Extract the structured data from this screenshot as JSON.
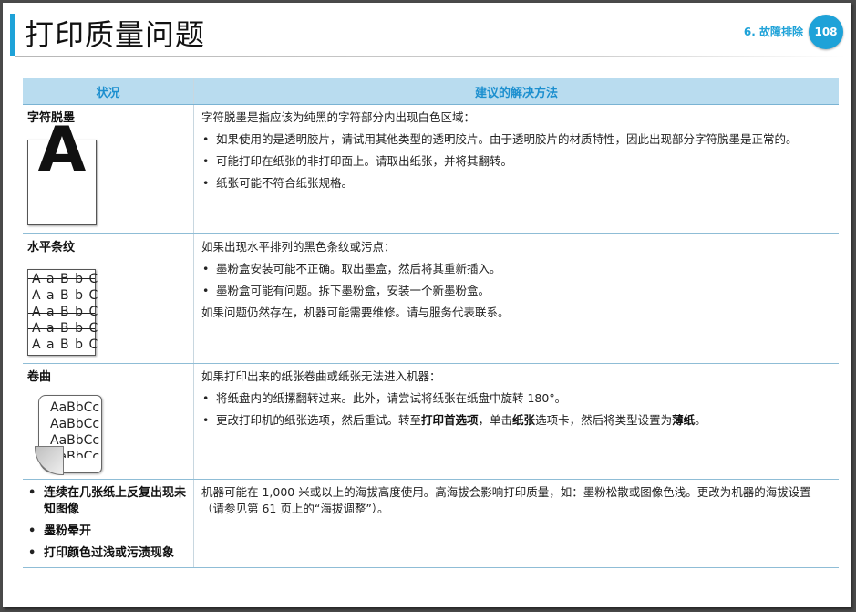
{
  "header": {
    "title": "打印质量问题",
    "chapter": "6. 故障排除",
    "page_number": "108",
    "accent_color": "#1ea2d8"
  },
  "table": {
    "columns": [
      "状况",
      "建议的解决方法"
    ],
    "rows": [
      {
        "condition": "字符脱墨",
        "illustration_letter": "A",
        "intro": "字符脱墨是指应该为纯黑的字符部分内出现白色区域：",
        "bullets": [
          "如果使用的是透明胶片，请试用其他类型的透明胶片。由于透明胶片的材质特性，因此出现部分字符脱墨是正常的。",
          "可能打印在纸张的非打印面上。请取出纸张，并将其翻转。",
          "纸张可能不符合纸张规格。"
        ]
      },
      {
        "condition": "水平条纹",
        "illustration_text": "A a B b C",
        "intro": "如果出现水平排列的黑色条纹或污点：",
        "bullets": [
          "墨粉盒安装可能不正确。取出墨盒，然后将其重新插入。",
          "墨粉盒可能有问题。拆下墨粉盒，安装一个新墨粉盒。"
        ],
        "outro": "如果问题仍然存在，机器可能需要维修。请与服务代表联系。"
      },
      {
        "condition": "卷曲",
        "illustration_text": "AaBbCc",
        "intro": "如果打印出来的纸张卷曲或纸张无法进入机器：",
        "bullet1": "将纸盘内的纸摞翻转过来。此外，请尝试将纸张在纸盘中旋转 180°。",
        "bullet2": {
          "part1": "更改打印机的纸张选项，然后重试。转至",
          "em1": "打印首选项",
          "part2": "，单击",
          "em2": "纸张",
          "part3": "选项卡，然后将类型设置为",
          "em3": "薄纸",
          "part4": "。"
        }
      },
      {
        "conditions": [
          "连续在几张纸上反复出现未知图像",
          "墨粉晕开",
          "打印颜色过浅或污渍现象"
        ],
        "solution": "机器可能在 1,000 米或以上的海拔高度使用。高海拔会影响打印质量，如：墨粉松散或图像色浅。更改为机器的海拔设置 （请参见第 61 页上的“海拔调整”）。"
      }
    ]
  }
}
